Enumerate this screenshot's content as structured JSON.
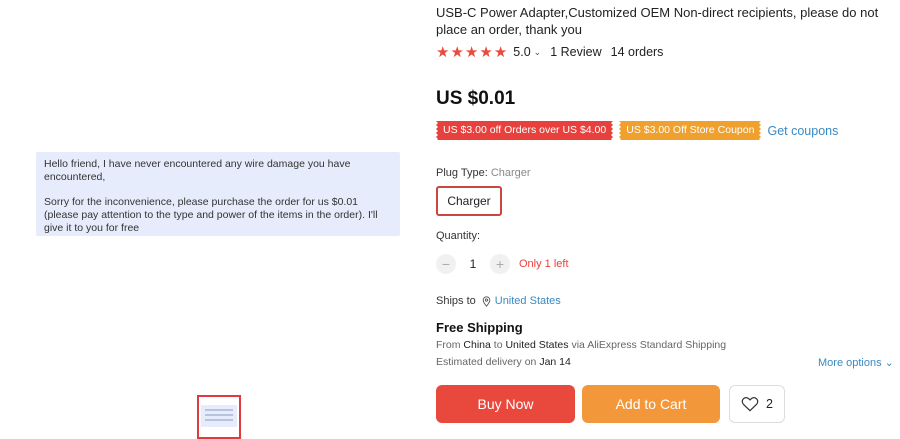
{
  "product": {
    "title": "USB-C Power Adapter,Customized OEM Non-direct recipients, please do not place an order, thank you",
    "rating": "5.0",
    "reviews": "1 Review",
    "orders": "14 orders",
    "price": "US $0.01"
  },
  "image_message": {
    "line1": "Hello friend, I have never encountered any wire damage you have encountered,",
    "line2": "Sorry for the inconvenience, please purchase the order for us $0.01 (please pay attention to the type and power of the items in the order). I'll give it to you for free"
  },
  "coupons": {
    "coupon1": "US $3.00 off Orders over US $4.00",
    "coupon2": "US $3.00 Off Store Coupon",
    "get_coupons": "Get coupons"
  },
  "plug": {
    "label": "Plug Type:",
    "selected": "Charger",
    "option": "Charger"
  },
  "quantity": {
    "label": "Quantity:",
    "value": "1",
    "minus": "−",
    "plus": "+",
    "stock": "Only 1 left"
  },
  "shipping": {
    "ships_to_label": "Ships to",
    "country": "United States",
    "free_shipping": "Free Shipping",
    "from_label": "From",
    "from": "China",
    "to_label": "to",
    "to": "United States",
    "via": "via AliExpress Standard Shipping",
    "est_label": "Estimated delivery on",
    "est_date": "Jan 14",
    "more_options": "More options"
  },
  "actions": {
    "buy_now": "Buy Now",
    "add_to_cart": "Add to Cart",
    "wishlist_count": "2"
  },
  "colors": {
    "accent_red": "#e8413d",
    "accent_orange": "#f2973a",
    "link_blue": "#3a8ac4",
    "star": "#e84c3d"
  }
}
